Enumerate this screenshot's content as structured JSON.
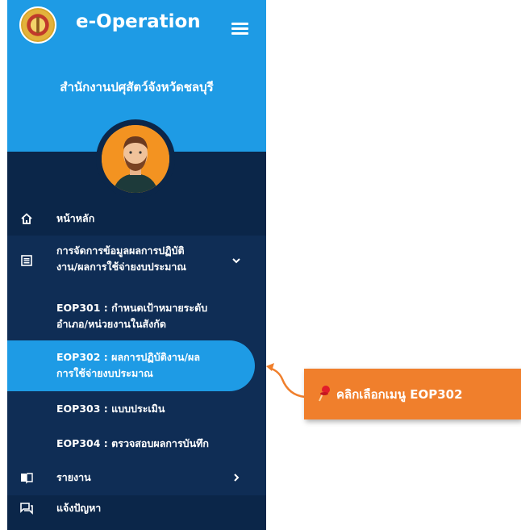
{
  "app": {
    "title": "e-Operation",
    "office": "สำนักงานปศุสัตว์จังหวัดชลบุรี"
  },
  "icons": {
    "logo": "emblem-logo",
    "menu": "hamburger-icon",
    "home": "home-icon",
    "data": "list-icon",
    "report": "book-icon",
    "issue": "chat-icon",
    "pin": "pushpin-icon"
  },
  "colors": {
    "sidebar": "#0b2649",
    "header": "#1e9be5",
    "active": "#1e9be5",
    "callout": "#f07f2c"
  },
  "menu": {
    "home": "หน้าหลัก",
    "data_group": {
      "line1": "การจัดการข้อมูลผลการปฏิบัติ",
      "line2": "งาน/ผลการใช้จ่ายงบประมาณ"
    },
    "sub": [
      {
        "line1": "EOP301 : กำหนดเป้าหมายระดับ",
        "line2": "อำเภอ/หน่วยงานในสังกัด"
      },
      {
        "line1": "EOP302 : ผลการปฏิบัติงาน/ผล",
        "line2": "การใช้จ่ายงบประมาณ"
      },
      {
        "line1": "EOP303 : แบบประเมิน"
      },
      {
        "line1": "EOP304 : ตรวจสอบผลการบันทึก"
      }
    ],
    "report": "รายงาน",
    "issue": "แจ้งปัญหา"
  },
  "callout": {
    "text": "คลิกเลือกเมนู EOP302"
  }
}
